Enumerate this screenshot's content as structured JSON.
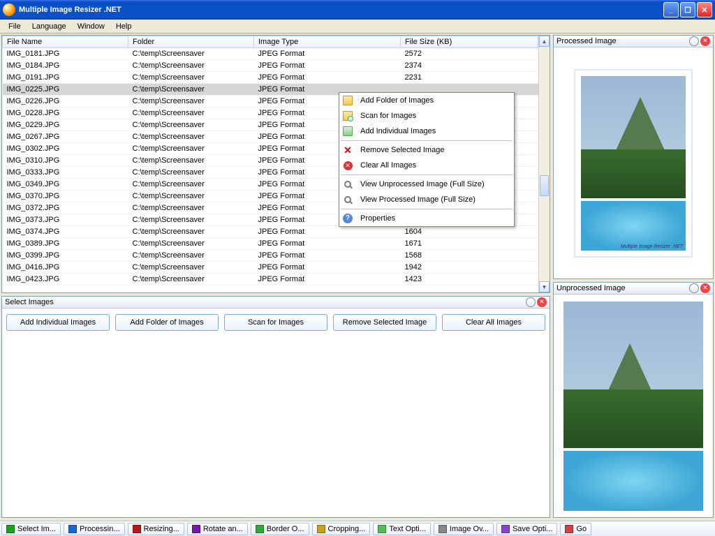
{
  "window": {
    "title": "Multiple Image Resizer .NET"
  },
  "menubar": [
    "File",
    "Language",
    "Window",
    "Help"
  ],
  "columns": {
    "file_name": "File Name",
    "folder": "Folder",
    "image_type": "Image Type",
    "file_size": "File Size (KB)"
  },
  "rows": [
    {
      "name": "IMG_0181.JPG",
      "folder": "C:\\temp\\Screensaver",
      "type": "JPEG Format",
      "size": "2572"
    },
    {
      "name": "IMG_0184.JPG",
      "folder": "C:\\temp\\Screensaver",
      "type": "JPEG Format",
      "size": "2374"
    },
    {
      "name": "IMG_0191.JPG",
      "folder": "C:\\temp\\Screensaver",
      "type": "JPEG Format",
      "size": "2231"
    },
    {
      "name": "IMG_0225.JPG",
      "folder": "C:\\temp\\Screensaver",
      "type": "JPEG Format",
      "size": ""
    },
    {
      "name": "IMG_0226.JPG",
      "folder": "C:\\temp\\Screensaver",
      "type": "JPEG Format",
      "size": ""
    },
    {
      "name": "IMG_0228.JPG",
      "folder": "C:\\temp\\Screensaver",
      "type": "JPEG Format",
      "size": ""
    },
    {
      "name": "IMG_0229.JPG",
      "folder": "C:\\temp\\Screensaver",
      "type": "JPEG Format",
      "size": ""
    },
    {
      "name": "IMG_0267.JPG",
      "folder": "C:\\temp\\Screensaver",
      "type": "JPEG Format",
      "size": ""
    },
    {
      "name": "IMG_0302.JPG",
      "folder": "C:\\temp\\Screensaver",
      "type": "JPEG Format",
      "size": ""
    },
    {
      "name": "IMG_0310.JPG",
      "folder": "C:\\temp\\Screensaver",
      "type": "JPEG Format",
      "size": ""
    },
    {
      "name": "IMG_0333.JPG",
      "folder": "C:\\temp\\Screensaver",
      "type": "JPEG Format",
      "size": ""
    },
    {
      "name": "IMG_0349.JPG",
      "folder": "C:\\temp\\Screensaver",
      "type": "JPEG Format",
      "size": ""
    },
    {
      "name": "IMG_0370.JPG",
      "folder": "C:\\temp\\Screensaver",
      "type": "JPEG Format",
      "size": ""
    },
    {
      "name": "IMG_0372.JPG",
      "folder": "C:\\temp\\Screensaver",
      "type": "JPEG Format",
      "size": ""
    },
    {
      "name": "IMG_0373.JPG",
      "folder": "C:\\temp\\Screensaver",
      "type": "JPEG Format",
      "size": ""
    },
    {
      "name": "IMG_0374.JPG",
      "folder": "C:\\temp\\Screensaver",
      "type": "JPEG Format",
      "size": "1604"
    },
    {
      "name": "IMG_0389.JPG",
      "folder": "C:\\temp\\Screensaver",
      "type": "JPEG Format",
      "size": "1671"
    },
    {
      "name": "IMG_0399.JPG",
      "folder": "C:\\temp\\Screensaver",
      "type": "JPEG Format",
      "size": "1568"
    },
    {
      "name": "IMG_0416.JPG",
      "folder": "C:\\temp\\Screensaver",
      "type": "JPEG Format",
      "size": "1942"
    },
    {
      "name": "IMG_0423.JPG",
      "folder": "C:\\temp\\Screensaver",
      "type": "JPEG Format",
      "size": "1423"
    }
  ],
  "selected_index": 3,
  "context_menu": {
    "add_folder": "Add Folder of Images",
    "scan": "Scan for Images",
    "add_individual": "Add Individual Images",
    "remove": "Remove Selected Image",
    "clear": "Clear All Images",
    "view_unprocessed": "View Unprocessed Image (Full Size)",
    "view_processed": "View Processed Image (Full Size)",
    "properties": "Properties"
  },
  "select_panel": {
    "title": "Select Images",
    "buttons": {
      "add_individual": "Add Individual Images",
      "add_folder": "Add Folder of Images",
      "scan": "Scan for Images",
      "remove": "Remove Selected Image",
      "clear": "Clear All Images"
    }
  },
  "preview": {
    "processed_title": "Processed Image",
    "unprocessed_title": "Unprocessed Image",
    "caption": "Multiple Image Resizer .NET"
  },
  "status_tabs": [
    {
      "label": "Select Im...",
      "color": "#1aa31a"
    },
    {
      "label": "Processin...",
      "color": "#1a66cc"
    },
    {
      "label": "Resizing...",
      "color": "#b41a1a"
    },
    {
      "label": "Rotate an...",
      "color": "#7a1aa3"
    },
    {
      "label": "Border O...",
      "color": "#33aa33"
    },
    {
      "label": "Cropping...",
      "color": "#c8a020"
    },
    {
      "label": "Text Opti...",
      "color": "#55bb55"
    },
    {
      "label": "Image Ov...",
      "color": "#888888"
    },
    {
      "label": "Save Opti...",
      "color": "#8844cc"
    },
    {
      "label": "Go",
      "color": "#cc4444"
    }
  ]
}
